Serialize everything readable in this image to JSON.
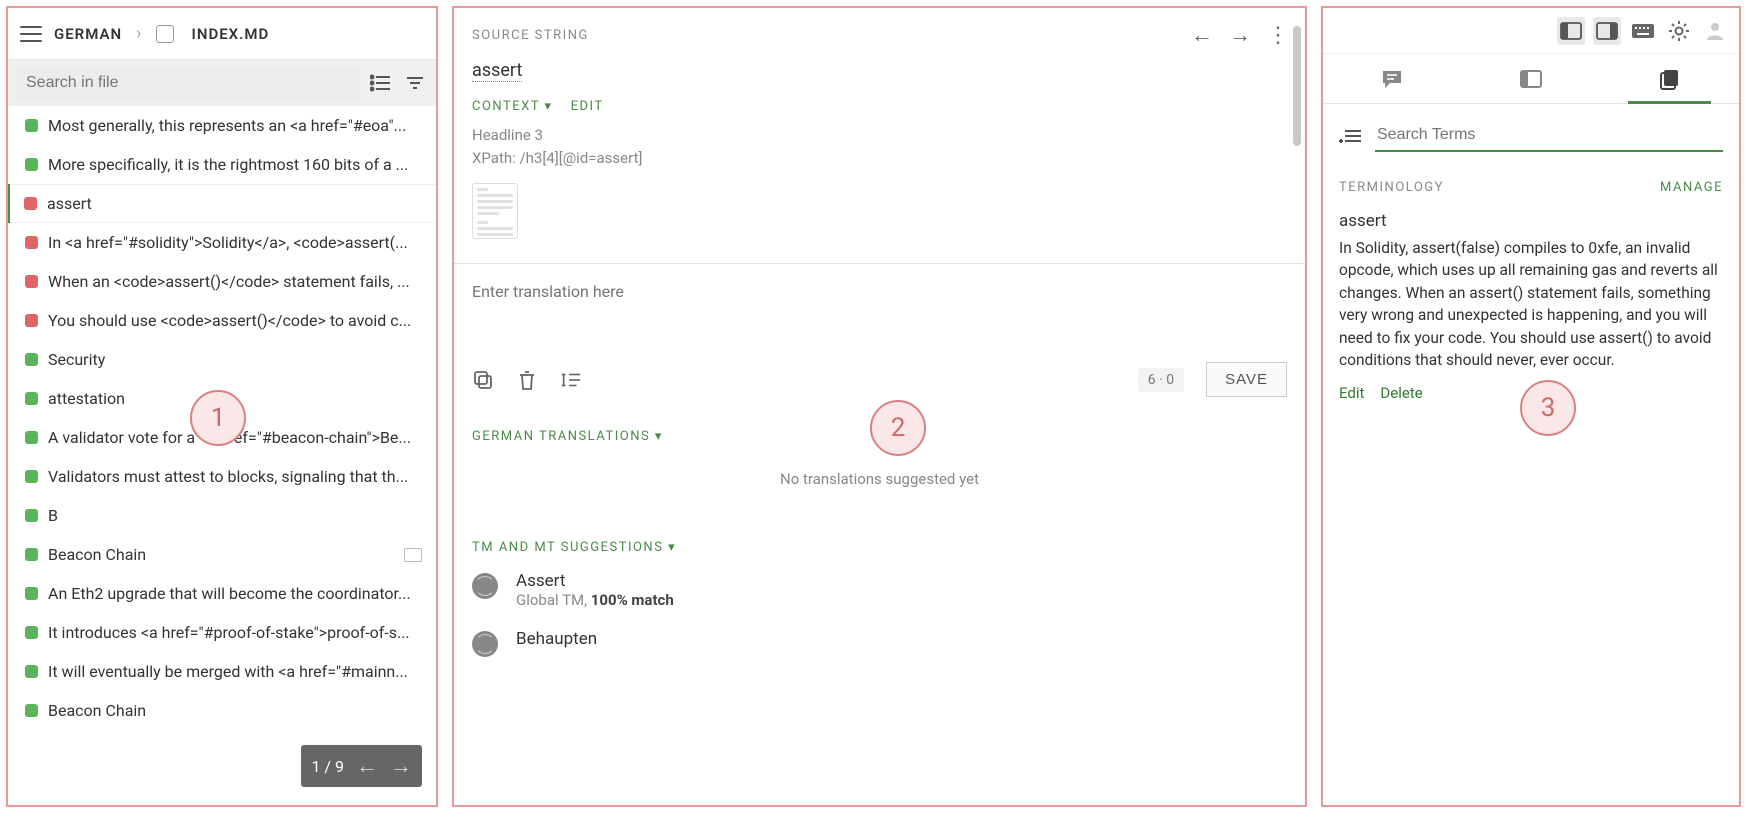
{
  "panel1": {
    "breadcrumb": {
      "language": "GERMAN",
      "file": "INDEX.MD"
    },
    "search_placeholder": "Search in file",
    "items": [
      {
        "status": "green",
        "text": "Most generally, this represents an <a href=\"#eoa\"...",
        "active": false
      },
      {
        "status": "green",
        "text": "More specifically, it is the rightmost 160 bits of a ...",
        "active": false
      },
      {
        "status": "red",
        "text": "assert",
        "active": true
      },
      {
        "status": "red",
        "text": "In <a href=\"#solidity\">Solidity</a>, <code>assert(...",
        "active": false
      },
      {
        "status": "red",
        "text": "When an <code>assert()</code> statement fails, ...",
        "active": false
      },
      {
        "status": "red",
        "text": "You should use <code>assert()</code> to avoid c...",
        "active": false
      },
      {
        "status": "green",
        "text": "Security",
        "active": false
      },
      {
        "status": "green",
        "text": "attestation",
        "active": false
      },
      {
        "status": "green",
        "text": "A validator vote for a <a href=\"#beacon-chain\">Be...",
        "active": false
      },
      {
        "status": "green",
        "text": "Validators must attest to blocks, signaling that th...",
        "active": false
      },
      {
        "status": "green",
        "text": "B",
        "active": false
      },
      {
        "status": "green",
        "text": "Beacon Chain",
        "active": false,
        "has_comment": true
      },
      {
        "status": "green",
        "text": "An Eth2 upgrade that will become the coordinator...",
        "active": false
      },
      {
        "status": "green",
        "text": "It introduces <a href=\"#proof-of-stake\">proof-of-s...",
        "active": false
      },
      {
        "status": "green",
        "text": "It will eventually be merged with <a href=\"#mainn...",
        "active": false
      },
      {
        "status": "green",
        "text": "Beacon Chain",
        "active": false
      }
    ],
    "pager": "1 / 9"
  },
  "panel2": {
    "source_label": "SOURCE STRING",
    "source_text": "assert",
    "context_label": "CONTEXT",
    "context_dropdown": "▾",
    "edit_label": "EDIT",
    "context_lines": {
      "headline": "Headline 3",
      "xpath": "XPath: /h3[4][@id=assert]"
    },
    "translation_placeholder": "Enter translation here",
    "counter": "6 · 0",
    "save_label": "SAVE",
    "translations_label": "GERMAN TRANSLATIONS",
    "no_translations": "No translations suggested yet",
    "tm_label": "TM AND MT SUGGESTIONS",
    "suggestions": [
      {
        "title": "Assert",
        "source": "Global TM, ",
        "match": "100% match"
      },
      {
        "title": "Behaupten",
        "source": "",
        "match": ""
      }
    ]
  },
  "panel3": {
    "search_placeholder": "Search Terms",
    "terminology_label": "TERMINOLOGY",
    "manage_label": "MANAGE",
    "term_title": "assert",
    "term_body": "In Solidity, assert(false) compiles to 0xfe, an invalid opcode, which uses up all remaining gas and reverts all changes. When an assert() statement fails, something very wrong and unexpected is happening, and you will need to fix your code. You should use assert() to avoid conditions that should never, ever occur.",
    "edit_label": "Edit",
    "delete_label": "Delete"
  },
  "callouts": {
    "c1": "1",
    "c2": "2",
    "c3": "3"
  }
}
